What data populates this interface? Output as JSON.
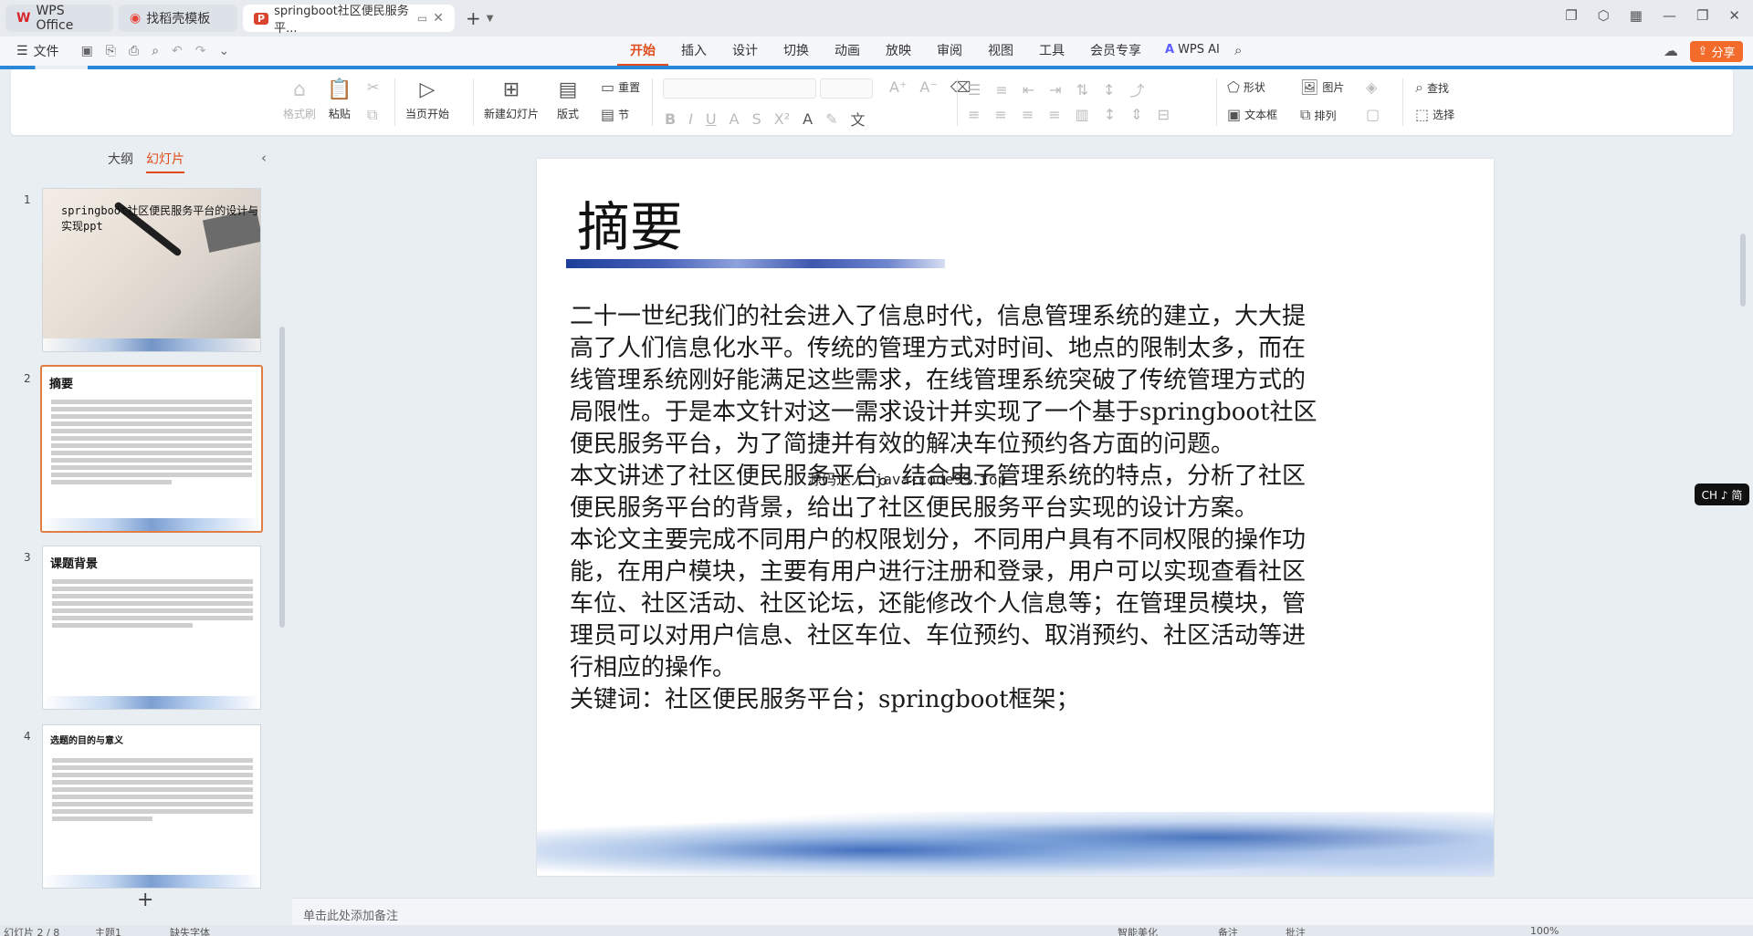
{
  "tabs": [
    {
      "label": "WPS Office",
      "icon": "wps-logo"
    },
    {
      "label": "找稻壳模板",
      "icon": "docer-logo"
    },
    {
      "label": "springboot社区便民服务平...",
      "icon": "ppt-logo"
    }
  ],
  "menu": {
    "file": "文件",
    "tabs": [
      "开始",
      "插入",
      "设计",
      "切换",
      "动画",
      "放映",
      "审阅",
      "视图",
      "工具",
      "会员专享"
    ],
    "active_tab": "开始",
    "wps_ai": "WPS AI",
    "share": "分享"
  },
  "ribbon": {
    "format_painter": "格式刷",
    "paste": "粘贴",
    "play_from_current": "当页开始",
    "new_slide": "新建幻灯片",
    "layout": "版式",
    "reset": "重置",
    "section": "节",
    "shape": "形状",
    "picture": "图片",
    "textbox": "文本框",
    "arrange": "排列",
    "find": "查找",
    "select": "选择"
  },
  "panel": {
    "tab_outline": "大纲",
    "tab_slides": "幻灯片",
    "active": "幻灯片"
  },
  "thumbnails": [
    {
      "num": "1",
      "title": "springboot社区便民服务平台的设计与实现ppt"
    },
    {
      "num": "2",
      "title": "摘要"
    },
    {
      "num": "3",
      "title": "课题背景"
    },
    {
      "num": "4",
      "title": "选题的目的与意义"
    }
  ],
  "slide": {
    "title": "摘要",
    "paragraphs": [
      "二十一世纪我们的社会进入了信息时代，信息管理系统的建立，大大提高了人们信息化水平。传统的管理方式对时间、地点的限制太多，而在线管理系统刚好能满足这些需求，在线管理系统突破了传统管理方式的局限性。于是本文针对这一需求设计并实现了一个基于springboot社区便民服务平台，为了简捷并有效的解决车位预约各方面的问题。",
      "本文讲述了社区便民服务平台。结合电子管理系统的特点，分析了社区便民服务平台的背景，给出了社区便民服务平台实现的设计方案。",
      "本论文主要完成不同用户的权限划分，不同用户具有不同权限的操作功能，在用户模块，主要有用户进行注册和登录，用户可以实现查看社区车位、社区活动、社区论坛，还能修改个人信息等；在管理员模块，管理员可以对用户信息、社区车位、车位预约、取消预约、社区活动等进行相应的操作。",
      "关键词：社区便民服务平台；springboot框架；"
    ],
    "watermark": "源码达人 java-code99.top"
  },
  "notes_placeholder": "单击此处添加备注",
  "ime": "CH ♪ 简",
  "status": {
    "slide_count": "幻灯片 2 / 8",
    "theme": "主题1",
    "missing_font": "缺失字体",
    "smart_beautify": "智能美化",
    "notes": "备注",
    "comments": "批注",
    "zoom": "100%"
  }
}
